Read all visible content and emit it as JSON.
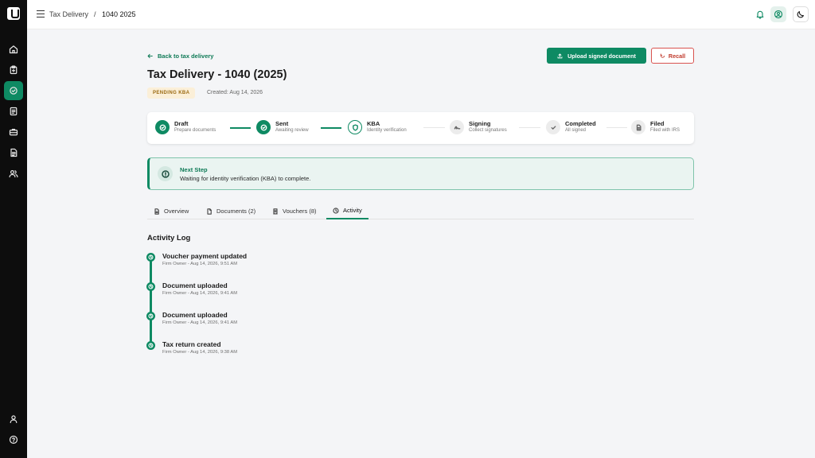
{
  "topbar": {
    "breadcrumb": [
      "Tax Delivery",
      "/",
      "1040 2025"
    ]
  },
  "sidebar": {
    "items": [
      "home-icon",
      "clipboard-icon",
      "check-circle-icon",
      "document-icon",
      "briefcase-icon",
      "file-text-icon",
      "users-icon"
    ],
    "bottom": [
      "user-icon",
      "help-icon"
    ]
  },
  "header": {
    "back_label": "Back to tax delivery",
    "title": "Tax Delivery - 1040 (2025)",
    "status": "PENDING KBA",
    "created": "Created: Aug 14, 2026",
    "upload_label": "Upload signed document",
    "recall_label": "Recall"
  },
  "steps": [
    {
      "name": "Draft",
      "sub": "Prepare documents",
      "state": "done"
    },
    {
      "name": "Sent",
      "sub": "Awaiting review",
      "state": "done"
    },
    {
      "name": "KBA",
      "sub": "Identity verification",
      "state": "current"
    },
    {
      "name": "Signing",
      "sub": "Collect signatures",
      "state": "todo"
    },
    {
      "name": "Completed",
      "sub": "All signed",
      "state": "todo"
    },
    {
      "name": "Filed",
      "sub": "Filed with IRS",
      "state": "todo"
    }
  ],
  "next_step": {
    "title": "Next Step",
    "desc": "Waiting for identity verification (KBA) to complete."
  },
  "tabs": [
    {
      "label": "Overview",
      "active": false
    },
    {
      "label": "Documents (2)",
      "active": false
    },
    {
      "label": "Vouchers (8)",
      "active": false
    },
    {
      "label": "Activity",
      "active": true
    }
  ],
  "activity": {
    "title": "Activity Log",
    "items": [
      {
        "title": "Voucher payment updated",
        "meta": "Firm Owner - Aug 14, 2026, 9:51 AM"
      },
      {
        "title": "Document uploaded",
        "meta": "Firm Owner - Aug 14, 2026, 9:41 AM"
      },
      {
        "title": "Document uploaded",
        "meta": "Firm Owner - Aug 14, 2026, 9:41 AM"
      },
      {
        "title": "Tax return created",
        "meta": "Firm Owner - Aug 14, 2026, 9:38 AM"
      }
    ]
  },
  "colors": {
    "accent": "#0e8a63",
    "sidebar": "#0d0d0d",
    "badge_bg": "#fbefd8",
    "danger": "#d9534f"
  }
}
